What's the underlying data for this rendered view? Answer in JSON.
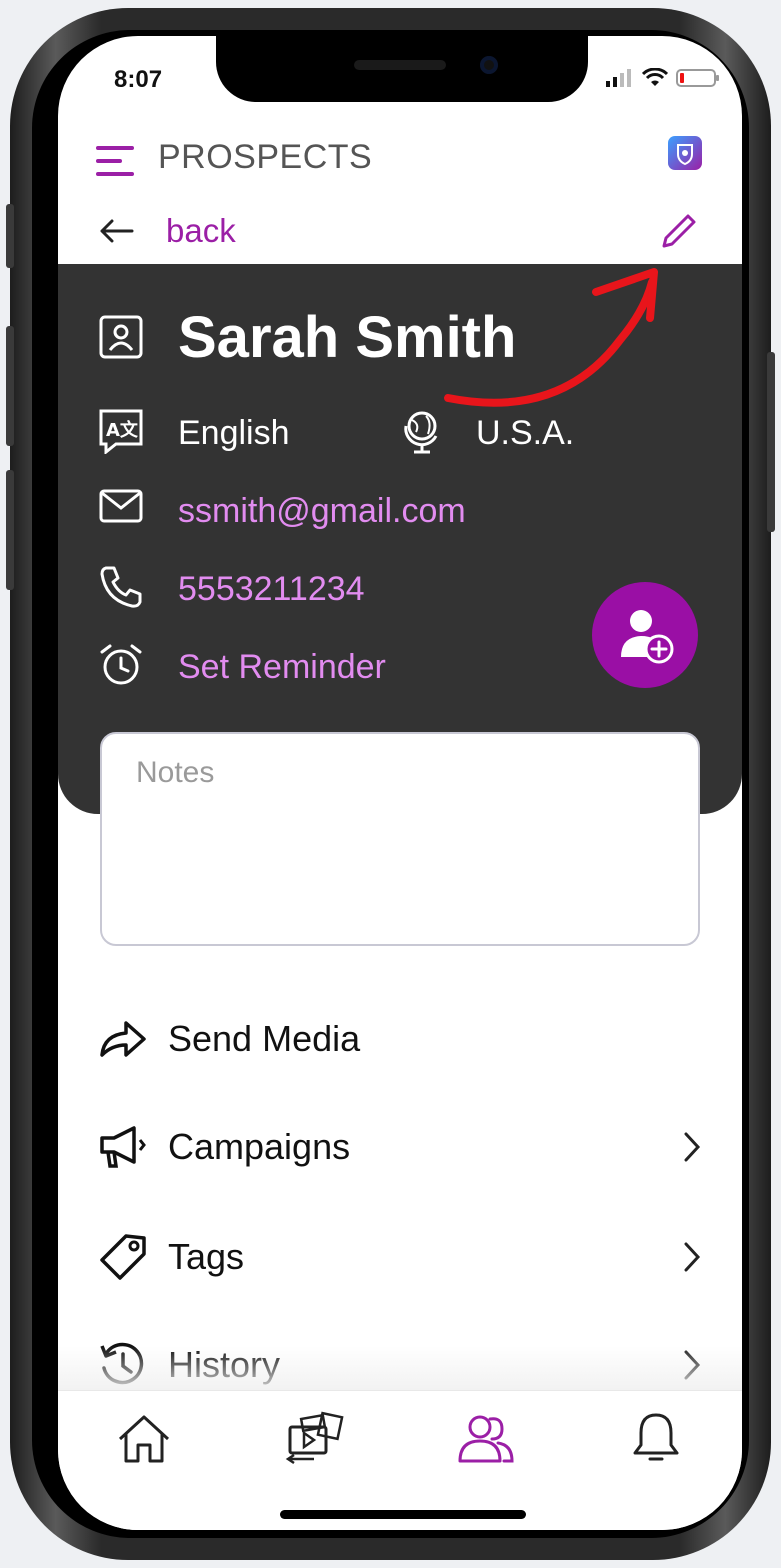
{
  "status_bar": {
    "time": "8:07"
  },
  "header": {
    "title": "PROSPECTS",
    "menu_icon": "hamburger-icon",
    "app_icon": "app-logo-icon"
  },
  "nav": {
    "back_label": "back",
    "edit_icon": "pencil-icon"
  },
  "prospect": {
    "name": "Sarah Smith",
    "language": "English",
    "country": "U.S.A.",
    "email": "ssmith@gmail.com",
    "phone": "5553211234",
    "reminder_label": "Set Reminder"
  },
  "notes": {
    "placeholder": "Notes"
  },
  "menu": {
    "items": [
      {
        "label": "Send Media",
        "icon": "share-arrow-icon"
      },
      {
        "label": "Campaigns",
        "icon": "megaphone-icon"
      },
      {
        "label": "Tags",
        "icon": "tag-icon"
      },
      {
        "label": "History",
        "icon": "history-icon"
      }
    ]
  },
  "tabbar": {
    "tabs": [
      {
        "icon": "home-icon"
      },
      {
        "icon": "media-icon"
      },
      {
        "icon": "contacts-icon",
        "active": true
      },
      {
        "icon": "bell-icon"
      }
    ]
  },
  "colors": {
    "accent": "#9b1fa6",
    "card": "#333333",
    "link": "#e28cf0",
    "annotation_arrow": "#e8151b"
  }
}
